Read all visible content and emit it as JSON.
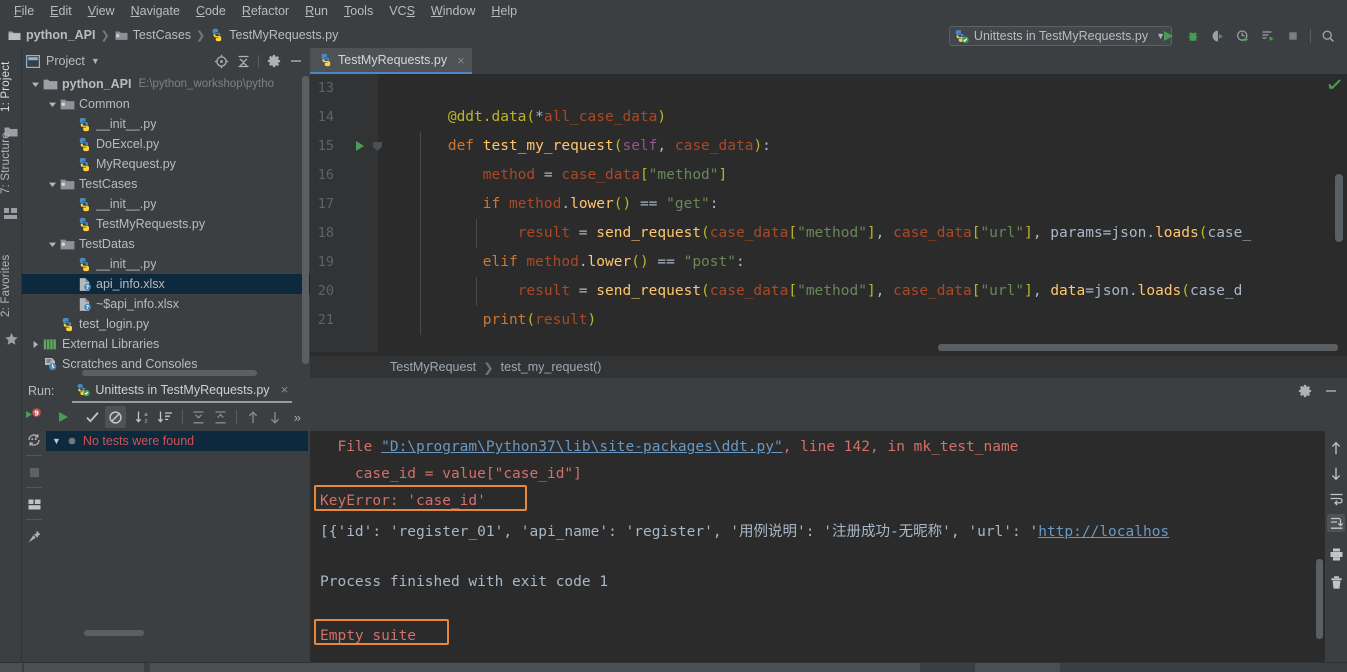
{
  "menu": {
    "items": [
      {
        "label": "File",
        "mnemonic": "F"
      },
      {
        "label": "Edit",
        "mnemonic": "E"
      },
      {
        "label": "View",
        "mnemonic": "V"
      },
      {
        "label": "Navigate",
        "mnemonic": "N"
      },
      {
        "label": "Code",
        "mnemonic": "C"
      },
      {
        "label": "Refactor",
        "mnemonic": "R"
      },
      {
        "label": "Run",
        "mnemonic": "R"
      },
      {
        "label": "Tools",
        "mnemonic": "T"
      },
      {
        "label": "VCS",
        "mnemonic": "S"
      },
      {
        "label": "Window",
        "mnemonic": "W"
      },
      {
        "label": "Help",
        "mnemonic": "H"
      }
    ]
  },
  "breadcrumb": {
    "items": [
      "python_API",
      "TestCases",
      "TestMyRequests.py"
    ]
  },
  "run_config": {
    "name": "Unittests in TestMyRequests.py",
    "icons": [
      "run-icon",
      "debug-icon",
      "run-coverage-icon",
      "profile-icon",
      "run-with-console-icon",
      "stop-icon"
    ]
  },
  "left_strip": {
    "tabs": [
      "1: Project",
      "7: Structure",
      "2: Favorites"
    ]
  },
  "project_panel": {
    "title": "Project",
    "header_icons": [
      "locate-icon",
      "collapse-all-icon",
      "settings-gear-icon",
      "hide-icon"
    ],
    "tree": [
      {
        "label": "python_API",
        "path": "E:\\python_workshop\\pytho",
        "icon": "folder-icon",
        "indent": 0,
        "arrow": "down",
        "bold": true,
        "selected": false
      },
      {
        "label": "Common",
        "icon": "package-folder-icon",
        "indent": 1,
        "arrow": "down",
        "bold": false,
        "selected": false
      },
      {
        "label": "__init__.py",
        "icon": "python-file-icon",
        "indent": 2,
        "arrow": "",
        "bold": false,
        "selected": false
      },
      {
        "label": "DoExcel.py",
        "icon": "python-file-icon",
        "indent": 2,
        "arrow": "",
        "bold": false,
        "selected": false
      },
      {
        "label": "MyRequest.py",
        "icon": "python-file-icon",
        "indent": 2,
        "arrow": "",
        "bold": false,
        "selected": false
      },
      {
        "label": "TestCases",
        "icon": "package-folder-icon",
        "indent": 1,
        "arrow": "down",
        "bold": false,
        "selected": false
      },
      {
        "label": "__init__.py",
        "icon": "python-file-icon",
        "indent": 2,
        "arrow": "",
        "bold": false,
        "selected": false
      },
      {
        "label": "TestMyRequests.py",
        "icon": "python-file-icon",
        "indent": 2,
        "arrow": "",
        "bold": false,
        "selected": false
      },
      {
        "label": "TestDatas",
        "icon": "package-folder-icon",
        "indent": 1,
        "arrow": "down",
        "bold": false,
        "selected": false
      },
      {
        "label": "__init__.py",
        "icon": "python-file-icon",
        "indent": 2,
        "arrow": "",
        "bold": false,
        "selected": false
      },
      {
        "label": "api_info.xlsx",
        "icon": "unknown-file-icon",
        "indent": 2,
        "arrow": "",
        "bold": false,
        "selected": true
      },
      {
        "label": "~$api_info.xlsx",
        "icon": "unknown-file-icon",
        "indent": 2,
        "arrow": "",
        "bold": false,
        "selected": false
      },
      {
        "label": "test_login.py",
        "icon": "python-file-icon",
        "indent": 1,
        "arrow": "",
        "bold": false,
        "selected": false
      },
      {
        "label": "External Libraries",
        "icon": "libraries-icon",
        "indent": 0,
        "arrow": "right",
        "bold": false,
        "selected": false
      },
      {
        "label": "Scratches and Consoles",
        "icon": "scratches-icon",
        "indent": 0,
        "arrow": "",
        "bold": false,
        "selected": false
      }
    ]
  },
  "editor": {
    "tab": {
      "label": "TestMyRequests.py",
      "icon": "python-file-icon",
      "close": "×"
    },
    "first_line_number": 13,
    "lines": [
      {
        "num": 13,
        "tokens": [],
        "gutter_icon": "",
        "text": ""
      },
      {
        "num": 14,
        "gutter_icon": "",
        "text": "        @ddt.data(*all_case_data)"
      },
      {
        "num": 15,
        "gutter_icon": "run-gutter-icon",
        "text": "        def test_my_request(self, case_data):"
      },
      {
        "num": 16,
        "gutter_icon": "",
        "text": "            method = case_data[\"method\"]"
      },
      {
        "num": 17,
        "gutter_icon": "",
        "text": "            if method.lower() == \"get\":"
      },
      {
        "num": 18,
        "gutter_icon": "",
        "text": "                result = send_request(case_data[\"method\"], case_data[\"url\"], params=json.loads(case_"
      },
      {
        "num": 19,
        "gutter_icon": "",
        "text": "            elif method.lower() == \"post\":"
      },
      {
        "num": 20,
        "gutter_icon": "",
        "text": "                result = send_request(case_data[\"method\"], case_data[\"url\"], data=json.loads(case_d"
      },
      {
        "num": 21,
        "gutter_icon": "",
        "text": "            print(result)"
      }
    ],
    "breadcrumb": [
      "TestMyRequest",
      "test_my_request()"
    ],
    "inspection_status": "inspections-ok-icon"
  },
  "run_panel": {
    "label": "Run:",
    "tab_title": "Unittests in TestMyRequests.py",
    "tab_close": "×",
    "header_icons": [
      "settings-gear-icon",
      "hide-icon"
    ],
    "toolbar_icons": [
      "rerun-icon",
      "show-passed-icon",
      "hide-ignored-icon",
      "sort-alphabetically-icon",
      "sort-by-duration-icon",
      "expand-all-icon",
      "collapse-all-icon",
      "previous-failed-icon",
      "next-failed-icon",
      "more-icon"
    ],
    "gutter_icons": [
      "rerun-failed-icon",
      "toggle-auto-test-icon",
      "stop-icon",
      "restore-layout-icon",
      "pin-tab-icon"
    ],
    "tests_tree": [
      {
        "label": "No tests were found",
        "status": "ignored"
      }
    ],
    "console": {
      "lines": [
        "  File \"D:\\program\\Python37\\lib\\site-packages\\ddt.py\", line 142, in mk_test_name",
        "    case_id = value[\"case_id\"]",
        "KeyError: 'case_id'",
        "[{'id': 'register_01', 'api_name': 'register', '用例说明': '注册成功-无昵称', 'url': 'http://localhos",
        "",
        "Process finished with exit code 1",
        "",
        "Empty suite"
      ],
      "highlighted": [
        "KeyError: 'case_id'",
        "Empty suite"
      ],
      "highlight_color": "#e8883a"
    },
    "rail_icons": [
      "up-arrow-icon",
      "down-arrow-icon",
      "soft-wrap-icon",
      "scroll-to-end-icon",
      "print-icon",
      "trash-icon"
    ]
  },
  "colors": {
    "ui_background": "#3c3f41",
    "editor_background": "#2b2b2b",
    "selection_blue": "#0d293e",
    "accent_orange": "#e8883a",
    "error_red": "#d25252",
    "tab_underline": "#4a88c7"
  }
}
